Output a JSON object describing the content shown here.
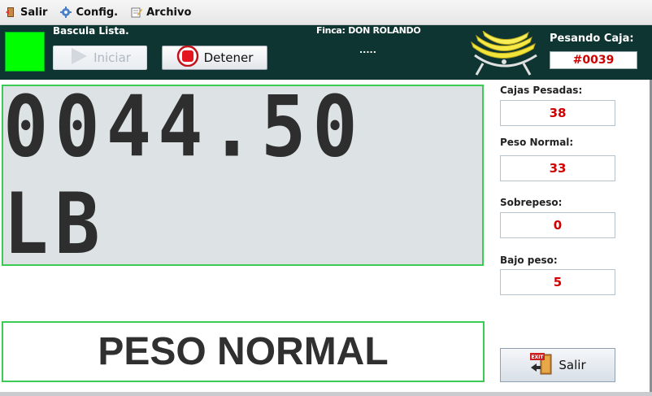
{
  "menu": {
    "items": [
      {
        "label": "Salir",
        "icon": "exit-door-icon"
      },
      {
        "label": "Config.",
        "icon": "gear-icon"
      },
      {
        "label": "Archivo",
        "icon": "edit-file-icon"
      }
    ]
  },
  "header": {
    "status_text": "Bascula Lista.",
    "status_color": "#00ff00",
    "iniciar_label": "Iniciar",
    "detener_label": "Detener",
    "farm_label": "Finca: DON ROLANDO",
    "farm_dots": ".....",
    "pesando_label": "Pesando Caja:",
    "caja_number": "#0039",
    "logo_icon": "banana-scale-logo"
  },
  "display": {
    "weight": "0044.50 LB",
    "status_message": "PESO NORMAL"
  },
  "stats": {
    "cajas_pesadas_label": "Cajas Pesadas:",
    "cajas_pesadas_value": "38",
    "peso_normal_label": "Peso Normal:",
    "peso_normal_value": "33",
    "sobrepeso_label": "Sobrepeso:",
    "sobrepeso_value": "0",
    "bajo_peso_label": "Bajo peso:",
    "bajo_peso_value": "5"
  },
  "footer": {
    "salir_label": "Salir"
  },
  "colors": {
    "header_bg": "#0e3532",
    "accent_green": "#3ccc55",
    "value_red": "#d10000"
  }
}
